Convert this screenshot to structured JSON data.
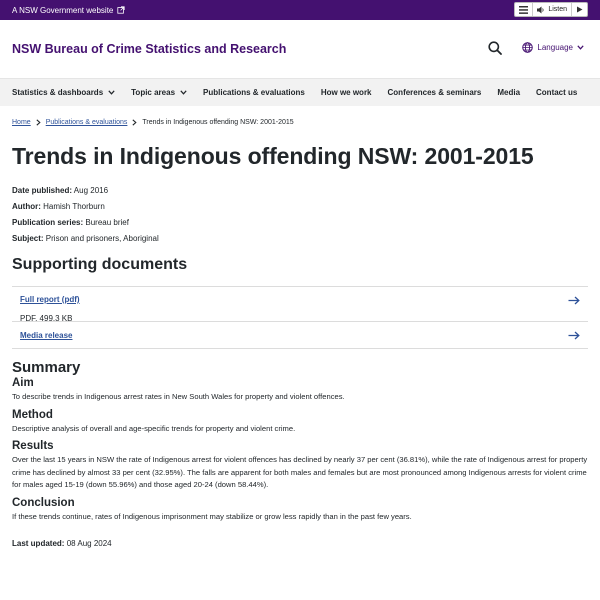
{
  "topbar": {
    "gov_link": "A NSW Government website",
    "listen_label": "Listen"
  },
  "header": {
    "site_title": "NSW Bureau of Crime Statistics and Research",
    "language_label": "Language"
  },
  "nav": {
    "items": [
      {
        "label": "Statistics & dashboards",
        "dropdown": true
      },
      {
        "label": "Topic areas",
        "dropdown": true
      },
      {
        "label": "Publications & evaluations",
        "dropdown": false
      },
      {
        "label": "How we work",
        "dropdown": false
      },
      {
        "label": "Conferences & seminars",
        "dropdown": false
      },
      {
        "label": "Media",
        "dropdown": false
      },
      {
        "label": "Contact us",
        "dropdown": false
      }
    ]
  },
  "breadcrumb": {
    "home": "Home",
    "section": "Publications & evaluations",
    "current": "Trends in Indigenous offending NSW: 2001-2015"
  },
  "page": {
    "title": "Trends in Indigenous offending NSW: 2001-2015",
    "meta": {
      "date_label": "Date published:",
      "date_value": "Aug 2016",
      "author_label": "Author:",
      "author_value": "Hamish Thorburn",
      "series_label": "Publication series:",
      "series_value": "Bureau brief",
      "subject_label": "Subject:",
      "subject_value": "Prison and prisoners, Aboriginal"
    }
  },
  "supporting": {
    "heading": "Supporting documents",
    "docs": [
      {
        "label": "Full report (pdf)",
        "meta": "PDF, 499.3 KB"
      },
      {
        "label": "Media release",
        "meta": ""
      }
    ]
  },
  "summary": {
    "heading": "Summary",
    "aim_heading": "Aim",
    "aim_text": "To describe trends in Indigenous arrest rates in New South Wales for property and violent offences.",
    "method_heading": "Method",
    "method_text": "Descriptive analysis of overall and age-specific trends for property and violent crime.",
    "results_heading": "Results",
    "results_text": "Over the last 15 years in NSW the rate of Indigenous arrest for violent offences has declined by nearly 37 per cent (36.81%), while the rate of Indigenous arrest for property crime has declined by almost 33 per cent (32.95%). The falls are apparent for both males and females but are most pronounced among Indigenous arrests for violent crime for males aged 15-19 (down 55.96%) and those aged 20-24 (down 58.44%).",
    "conclusion_heading": "Conclusion",
    "conclusion_text": "If these trends continue, rates of Indigenous imprisonment may stabilize or grow less rapidly than in the past few years."
  },
  "footer": {
    "updated_label": "Last updated:",
    "updated_value": "08 Aug 2024"
  },
  "colors": {
    "brand": "#441170",
    "link": "#2e5299",
    "text": "#22272b",
    "nav_bg": "#f2f2f2"
  },
  "icons": [
    "external-link-icon",
    "menu-icon",
    "speaker-icon",
    "play-icon",
    "search-icon",
    "globe-icon",
    "chevron-down-icon",
    "chevron-right-icon",
    "arrow-right-icon"
  ]
}
